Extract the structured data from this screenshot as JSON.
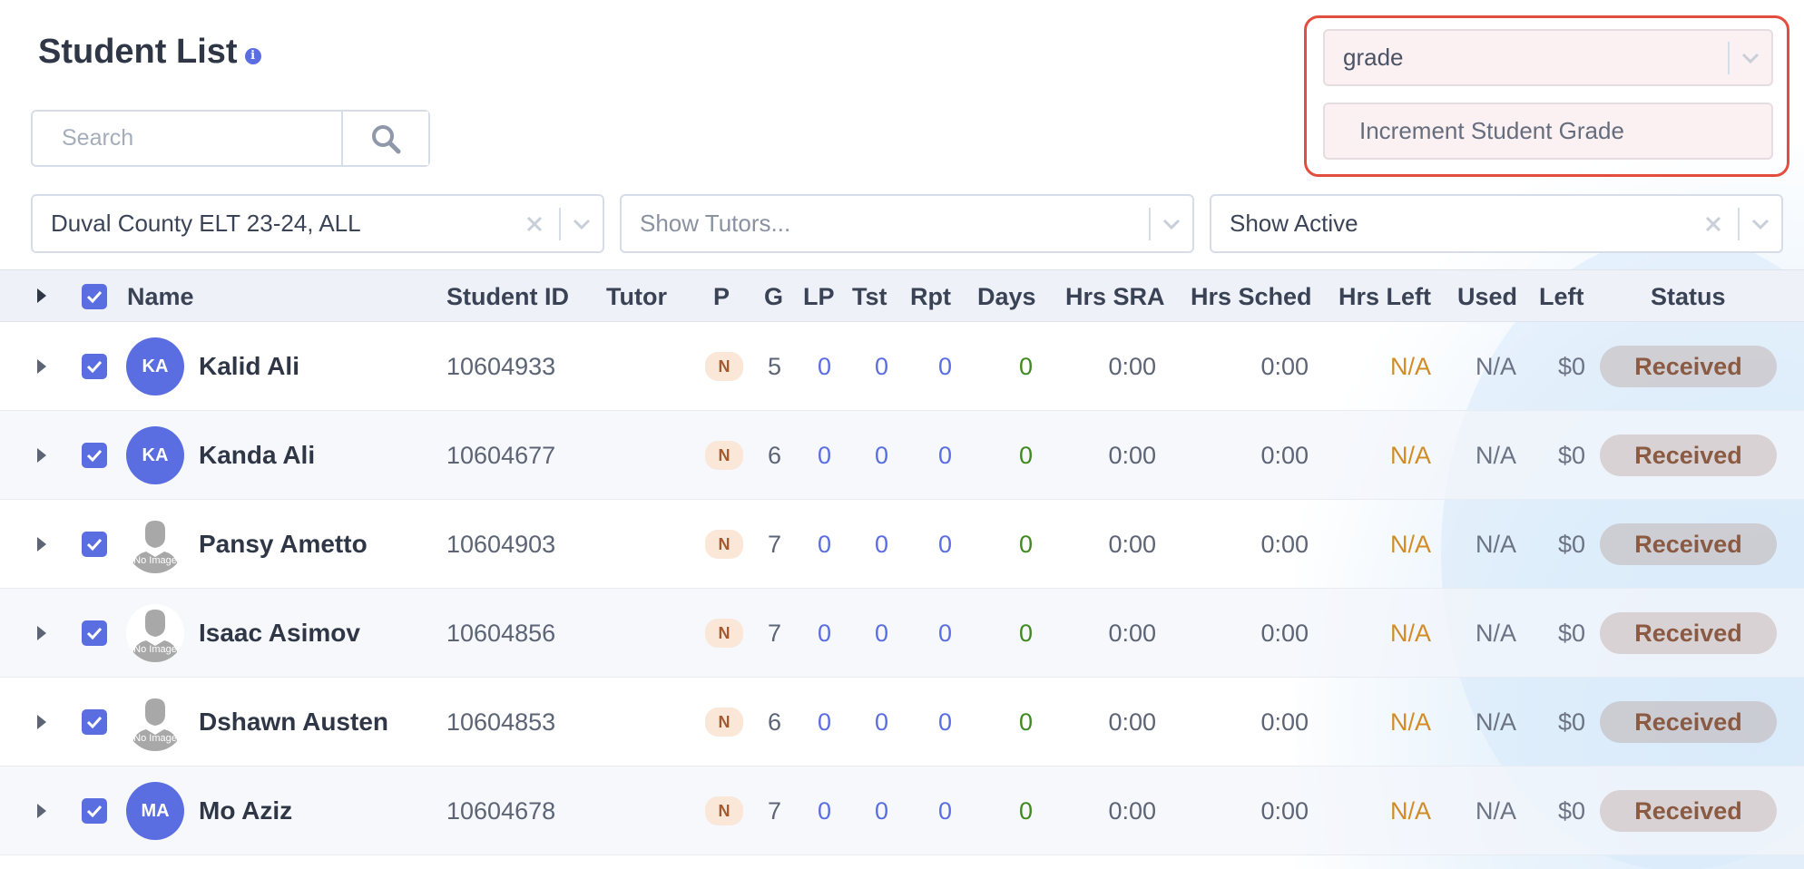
{
  "page": {
    "title": "Student List"
  },
  "search": {
    "placeholder": "Search",
    "value": ""
  },
  "action_select": {
    "value": "grade",
    "option": "Increment Student Grade"
  },
  "filters": {
    "program": "Duval County ELT 23-24, ALL",
    "tutors_placeholder": "Show Tutors...",
    "status": "Show Active"
  },
  "columns": {
    "name": "Name",
    "student_id": "Student ID",
    "tutor": "Tutor",
    "p": "P",
    "g": "G",
    "lp": "LP",
    "tst": "Tst",
    "rpt": "Rpt",
    "days": "Days",
    "hrs_sra": "Hrs SRA",
    "hrs_sched": "Hrs Sched",
    "hrs_left": "Hrs Left",
    "used": "Used",
    "left": "Left",
    "status": "Status"
  },
  "rows": [
    {
      "initials": "KA",
      "has_image": true,
      "name": "Kalid Ali",
      "student_id": "10604933",
      "tutor": "",
      "p": "N",
      "g": "5",
      "lp": "0",
      "tst": "0",
      "rpt": "0",
      "days": "0",
      "hrs_sra": "0:00",
      "hrs_sched": "0:00",
      "hrs_left": "N/A",
      "used": "N/A",
      "left": "$0",
      "status": "Received"
    },
    {
      "initials": "KA",
      "has_image": true,
      "name": "Kanda Ali",
      "student_id": "10604677",
      "tutor": "",
      "p": "N",
      "g": "6",
      "lp": "0",
      "tst": "0",
      "rpt": "0",
      "days": "0",
      "hrs_sra": "0:00",
      "hrs_sched": "0:00",
      "hrs_left": "N/A",
      "used": "N/A",
      "left": "$0",
      "status": "Received"
    },
    {
      "initials": "",
      "has_image": false,
      "no_image_text": "No Image",
      "name": "Pansy Ametto",
      "student_id": "10604903",
      "tutor": "",
      "p": "N",
      "g": "7",
      "lp": "0",
      "tst": "0",
      "rpt": "0",
      "days": "0",
      "hrs_sra": "0:00",
      "hrs_sched": "0:00",
      "hrs_left": "N/A",
      "used": "N/A",
      "left": "$0",
      "status": "Received"
    },
    {
      "initials": "",
      "has_image": false,
      "no_image_text": "No Image",
      "name": "Isaac Asimov",
      "student_id": "10604856",
      "tutor": "",
      "p": "N",
      "g": "7",
      "lp": "0",
      "tst": "0",
      "rpt": "0",
      "days": "0",
      "hrs_sra": "0:00",
      "hrs_sched": "0:00",
      "hrs_left": "N/A",
      "used": "N/A",
      "left": "$0",
      "status": "Received"
    },
    {
      "initials": "",
      "has_image": false,
      "no_image_text": "No Image",
      "name": "Dshawn Austen",
      "student_id": "10604853",
      "tutor": "",
      "p": "N",
      "g": "6",
      "lp": "0",
      "tst": "0",
      "rpt": "0",
      "days": "0",
      "hrs_sra": "0:00",
      "hrs_sched": "0:00",
      "hrs_left": "N/A",
      "used": "N/A",
      "left": "$0",
      "status": "Received"
    },
    {
      "initials": "MA",
      "has_image": true,
      "name": "Mo Aziz",
      "student_id": "10604678",
      "tutor": "",
      "p": "N",
      "g": "7",
      "lp": "0",
      "tst": "0",
      "rpt": "0",
      "days": "0",
      "hrs_sra": "0:00",
      "hrs_sched": "0:00",
      "hrs_left": "N/A",
      "used": "N/A",
      "left": "$0",
      "status": "Received"
    }
  ],
  "colors": {
    "accent": "#5b6ee1",
    "highlight_border": "#e24d3d",
    "status_text": "#8a5a43",
    "na_orange": "#d28c25",
    "days_green": "#3f8a1f"
  },
  "icons": {
    "info": "info-icon",
    "search": "search-icon",
    "clear": "close-icon",
    "chevron": "chevron-down-icon",
    "expander": "caret-right-icon",
    "checkbox": "checkbox-checked-icon",
    "no_image": "person-silhouette-icon"
  }
}
